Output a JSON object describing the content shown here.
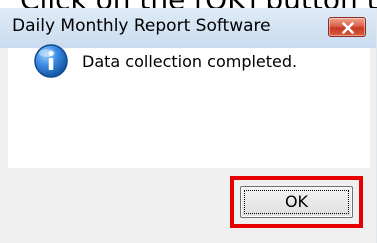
{
  "caption": {
    "text": "Click on the [OK] button to re"
  },
  "dialog": {
    "title": "Daily Monthly Report Software",
    "message": "Data collection completed.",
    "ok_label": "OK",
    "icons": {
      "info": "info-icon",
      "close": "close-icon"
    }
  },
  "colors": {
    "highlight": "#e60000",
    "close_button": "#c63a24",
    "info_icon": "#2c74c7",
    "title_bar": "#c9dcef",
    "dialog_background": "#f0f0f0"
  }
}
